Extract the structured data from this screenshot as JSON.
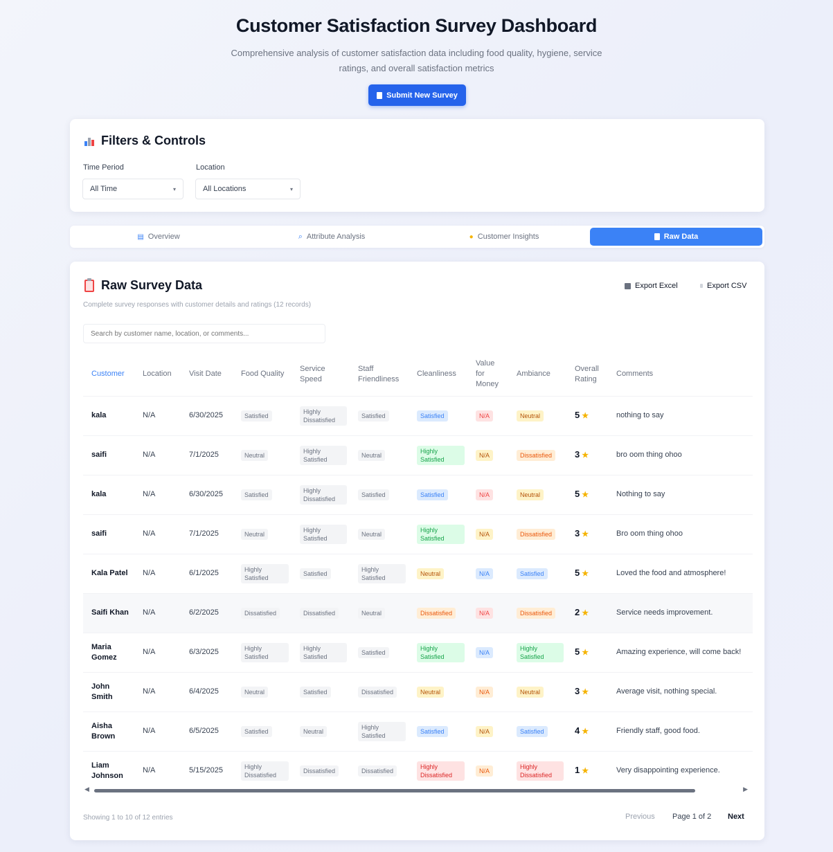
{
  "header": {
    "title": "Customer Satisfaction Survey Dashboard",
    "subtitle_line1": "Comprehensive analysis of customer satisfaction data including food quality, hygiene, service",
    "subtitle_line2": "ratings, and overall satisfaction metrics",
    "submit_label": "Submit New Survey"
  },
  "filters": {
    "title": "Filters & Controls",
    "time_label": "Time Period",
    "time_value": "All Time",
    "location_label": "Location",
    "location_value": "All Locations"
  },
  "tabs": [
    {
      "label": "Overview",
      "active": false
    },
    {
      "label": "Attribute Analysis",
      "active": false
    },
    {
      "label": "Customer Insights",
      "active": false
    },
    {
      "label": "Raw Data",
      "active": true
    }
  ],
  "raw": {
    "title": "Raw Survey Data",
    "subtitle": "Complete survey responses with customer details and ratings (12 records)",
    "export_excel": "Export Excel",
    "export_csv": "Export CSV",
    "search_placeholder": "Search by customer name, location, or comments...",
    "columns": [
      "Customer",
      "Location",
      "Visit Date",
      "Food Quality",
      "Service Speed",
      "Staff Friendliness",
      "Cleanliness",
      "Value for Money",
      "Ambiance",
      "Overall Rating",
      "Comments"
    ],
    "rows": [
      {
        "customer": "kala",
        "location": "N/A",
        "date": "6/30/2025",
        "food": "Satisfied",
        "service": "Highly Dissatisfied",
        "staff": "Satisfied",
        "clean": "Satisfied",
        "value": "N/A",
        "ambiance": "Neutral",
        "rating": "5",
        "comment": "nothing to say"
      },
      {
        "customer": "saifi",
        "location": "N/A",
        "date": "7/1/2025",
        "food": "Neutral",
        "service": "Highly Satisfied",
        "staff": "Neutral",
        "clean": "Highly Satisfied",
        "value": "N/A",
        "ambiance": "Dissatisfied",
        "rating": "3",
        "comment": "bro oom thing ohoo"
      },
      {
        "customer": "kala",
        "location": "N/A",
        "date": "6/30/2025",
        "food": "Satisfied",
        "service": "Highly Dissatisfied",
        "staff": "Satisfied",
        "clean": "Satisfied",
        "value": "N/A",
        "ambiance": "Neutral",
        "rating": "5",
        "comment": "Nothing to say"
      },
      {
        "customer": "saifi",
        "location": "N/A",
        "date": "7/1/2025",
        "food": "Neutral",
        "service": "Highly Satisfied",
        "staff": "Neutral",
        "clean": "Highly Satisfied",
        "value": "N/A",
        "ambiance": "Dissatisfied",
        "rating": "3",
        "comment": "Bro oom thing ohoo"
      },
      {
        "customer": "Kala Patel",
        "location": "N/A",
        "date": "6/1/2025",
        "food": "Highly Satisfied",
        "service": "Satisfied",
        "staff": "Highly Satisfied",
        "clean": "Neutral",
        "value": "N/A",
        "ambiance": "Satisfied",
        "rating": "5",
        "comment": "Loved the food and atmosphere!"
      },
      {
        "customer": "Saifi Khan",
        "location": "N/A",
        "date": "6/2/2025",
        "food": "Dissatisfied",
        "service": "Dissatisfied",
        "staff": "Neutral",
        "clean": "Dissatisfied",
        "value": "N/A",
        "ambiance": "Dissatisfied",
        "rating": "2",
        "comment": "Service needs improvement."
      },
      {
        "customer": "Maria Gomez",
        "location": "N/A",
        "date": "6/3/2025",
        "food": "Highly Satisfied",
        "service": "Highly Satisfied",
        "staff": "Satisfied",
        "clean": "Highly Satisfied",
        "value": "N/A",
        "ambiance": "Highly Satisfied",
        "rating": "5",
        "comment": "Amazing experience, will come back!"
      },
      {
        "customer": "John Smith",
        "location": "N/A",
        "date": "6/4/2025",
        "food": "Neutral",
        "service": "Satisfied",
        "staff": "Dissatisfied",
        "clean": "Neutral",
        "value": "N/A",
        "ambiance": "Neutral",
        "rating": "3",
        "comment": "Average visit, nothing special."
      },
      {
        "customer": "Aisha Brown",
        "location": "N/A",
        "date": "6/5/2025",
        "food": "Satisfied",
        "service": "Neutral",
        "staff": "Highly Satisfied",
        "clean": "Satisfied",
        "value": "N/A",
        "ambiance": "Satisfied",
        "rating": "4",
        "comment": "Friendly staff, good food."
      },
      {
        "customer": "Liam Johnson",
        "location": "N/A",
        "date": "5/15/2025",
        "food": "Highly Dissatisfied",
        "service": "Dissatisfied",
        "staff": "Dissatisfied",
        "clean": "Highly Dissatisfied",
        "value": "N/A",
        "ambiance": "Highly Dissatisfied",
        "rating": "1",
        "comment": "Very disappointing experience."
      }
    ],
    "showing": "Showing 1 to 10 of 12 entries",
    "previous": "Previous",
    "page": "Page 1 of 2",
    "next": "Next"
  },
  "colors": {
    "accent": "#2563eb",
    "tab_active": "#3b82f6",
    "star": "#f5b301"
  }
}
